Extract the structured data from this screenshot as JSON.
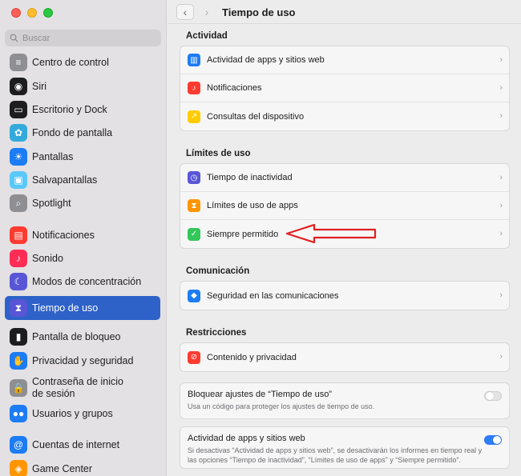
{
  "sidebar": {
    "search_placeholder": "Buscar",
    "items": [
      {
        "label": "Centro de control",
        "icon": "control-center-icon",
        "color": "#8e8e93"
      },
      {
        "label": "Siri",
        "icon": "siri-icon",
        "color": "#1d1d1f"
      },
      {
        "label": "Escritorio y Dock",
        "icon": "desktop-dock-icon",
        "color": "#1d1d1f"
      },
      {
        "label": "Fondo de pantalla",
        "icon": "wallpaper-icon",
        "color": "#34aadc"
      },
      {
        "label": "Pantallas",
        "icon": "displays-icon",
        "color": "#1c7cf4"
      },
      {
        "label": "Salvapantallas",
        "icon": "screensaver-icon",
        "color": "#5ac8fa"
      },
      {
        "label": "Spotlight",
        "icon": "spotlight-icon",
        "color": "#8e8e93"
      },
      {
        "label": "Notificaciones",
        "icon": "notifications-icon",
        "color": "#ff3b30"
      },
      {
        "label": "Sonido",
        "icon": "sound-icon",
        "color": "#ff2d55"
      },
      {
        "label": "Modos de concentración",
        "icon": "focus-icon",
        "color": "#5856d6"
      },
      {
        "label": "Tiempo de uso",
        "icon": "screen-time-icon",
        "color": "#5856d6",
        "active": true
      },
      {
        "label": "Pantalla de bloqueo",
        "icon": "lock-screen-icon",
        "color": "#1d1d1f"
      },
      {
        "label": "Privacidad y seguridad",
        "icon": "privacy-hand-icon",
        "color": "#1c7cf4"
      },
      {
        "label": "Contraseña de inicio de sesión",
        "icon": "login-password-icon",
        "color": "#8e8e93"
      },
      {
        "label": "Usuarios y grupos",
        "icon": "users-groups-icon",
        "color": "#1c7cf4"
      },
      {
        "label": "Cuentas de internet",
        "icon": "internet-accounts-icon",
        "color": "#1c7cf4"
      },
      {
        "label": "Game Center",
        "icon": "game-center-icon",
        "color": "#ff9500"
      }
    ]
  },
  "toolbar": {
    "title": "Tiempo de uso",
    "back": "‹",
    "forward": "›"
  },
  "sections": {
    "actividad": {
      "title": "Actividad",
      "rows": [
        {
          "label": "Actividad de apps y sitios web",
          "icon": "activity-chart-icon",
          "color": "#1c7cf4"
        },
        {
          "label": "Notificaciones",
          "icon": "notifications-bell-icon",
          "color": "#ff3b30"
        },
        {
          "label": "Consultas del dispositivo",
          "icon": "pickups-icon",
          "color": "#ffcc00"
        }
      ]
    },
    "limites": {
      "title": "Límites de uso",
      "rows": [
        {
          "label": "Tiempo de inactividad",
          "icon": "downtime-icon",
          "color": "#5856d6"
        },
        {
          "label": "Límites de uso de apps",
          "icon": "hourglass-icon",
          "color": "#ff9500"
        },
        {
          "label": "Siempre permitido",
          "icon": "checkmark-badge-icon",
          "color": "#34c759"
        }
      ]
    },
    "comunicacion": {
      "title": "Comunicación",
      "rows": [
        {
          "label": "Seguridad en las comunicaciones",
          "icon": "communication-safety-icon",
          "color": "#1c7cf4"
        }
      ]
    },
    "restricciones": {
      "title": "Restricciones",
      "rows": [
        {
          "label": "Contenido y privacidad",
          "icon": "restriction-icon",
          "color": "#ff3b30"
        }
      ]
    }
  },
  "toggles": {
    "bloquear": {
      "title": "Bloquear ajustes de “Tiempo de uso”",
      "description": "Usa un código para proteger los ajustes de tiempo de uso.",
      "on": false
    },
    "actividad": {
      "title": "Actividad de apps y sitios web",
      "description": "Si desactivas “Actividad de apps y sitios web”, se desactivarán los informes en tiempo real y las opciones “Tiempo de inactividad”, “Límites de uso de apps” y “Siempre permitido”.",
      "on": true
    }
  },
  "annotation": {
    "arrow_color": "#e02020"
  }
}
